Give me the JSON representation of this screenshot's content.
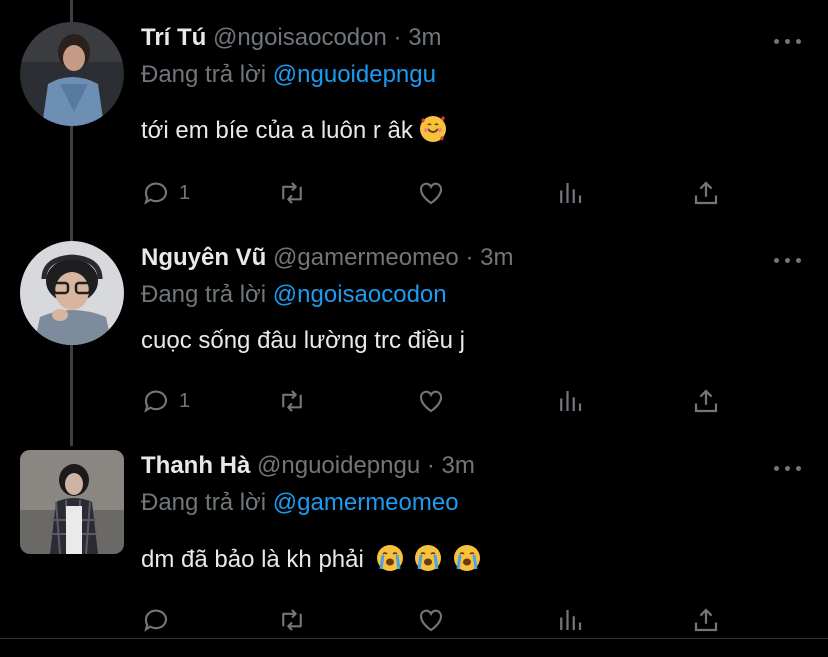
{
  "tweets": [
    {
      "name": "Trí Tú",
      "handle": "@ngoisaocodon",
      "dot": "·",
      "time": "3m",
      "reply_prefix": "Đang trả lời",
      "reply_mention": "@nguoidepngu",
      "text": "tới em bíe của a luôn r âk",
      "reply_count": "1",
      "emoji": [
        "smiling-face-with-hearts"
      ]
    },
    {
      "name": "Nguyên Vũ",
      "handle": "@gamermeomeo",
      "dot": "·",
      "time": "3m",
      "reply_prefix": "Đang trả lời",
      "reply_mention": "@ngoisaocodon",
      "text": "cuọc sống đâu lường trc điều j",
      "reply_count": "1",
      "emoji": []
    },
    {
      "name": "Thanh Hà",
      "handle": "@nguoidepngu",
      "dot": "·",
      "time": "3m",
      "reply_prefix": "Đang trả lời",
      "reply_mention": "@gamermeomeo",
      "text": "dm đã bảo là kh phải",
      "reply_count": "",
      "emoji": [
        "loudly-crying-face",
        "loudly-crying-face",
        "loudly-crying-face"
      ]
    }
  ],
  "colors": {
    "background": "#000000",
    "accent": "#1d9bf0",
    "muted": "#71767b",
    "text": "#e7e9ea"
  },
  "icons": [
    "reply-icon",
    "retweet-icon",
    "like-icon",
    "analytics-icon",
    "share-icon",
    "more-icon"
  ]
}
